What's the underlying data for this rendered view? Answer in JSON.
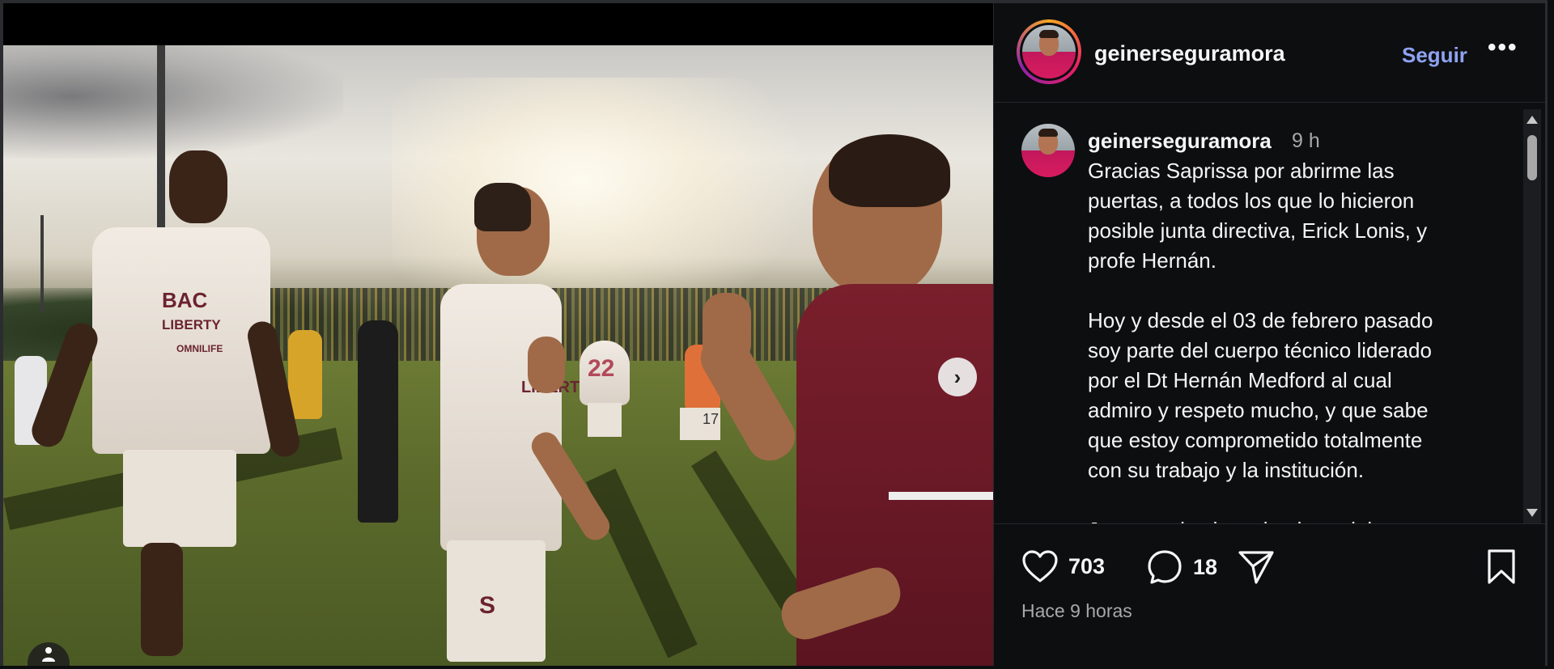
{
  "post": {
    "username": "geinerseguramora",
    "follow_label": "Seguir",
    "more_label": "•••"
  },
  "comment": {
    "username": "geinerseguramora",
    "time": "9 h",
    "caption": "Gracias Saprissa por abrirme las\npuertas, a todos los que lo hicieron\nposible junta directiva, Erick Lonis, y\nprofe Hernán.\n\nHoy y desde el 03 de febrero pasado\nsoy parte del cuerpo técnico liderado\npor el Dt Hernán Medford al cual\nadmiro y respeto mucho, y que sabe\nque estoy comprometido totalmente\ncon su trabajo y la institución.\n\nJuntos todos los miembros del cuerpo"
  },
  "actions": {
    "likes": "703",
    "comments": "18",
    "posted_ago": "Hace 9 horas"
  },
  "photo": {
    "jersey_texts": [
      "BAC",
      "LIBERTY",
      "OMNILIFE",
      "S",
      "22",
      "17"
    ]
  },
  "icons": {
    "next": "chevron-right-icon",
    "like": "heart-icon",
    "comment": "comment-bubble-icon",
    "share": "paper-plane-icon",
    "save": "bookmark-icon",
    "tag": "user-tag-icon"
  },
  "colors": {
    "follow_accent": "#8ea3f2",
    "background": "#0d0e10"
  }
}
